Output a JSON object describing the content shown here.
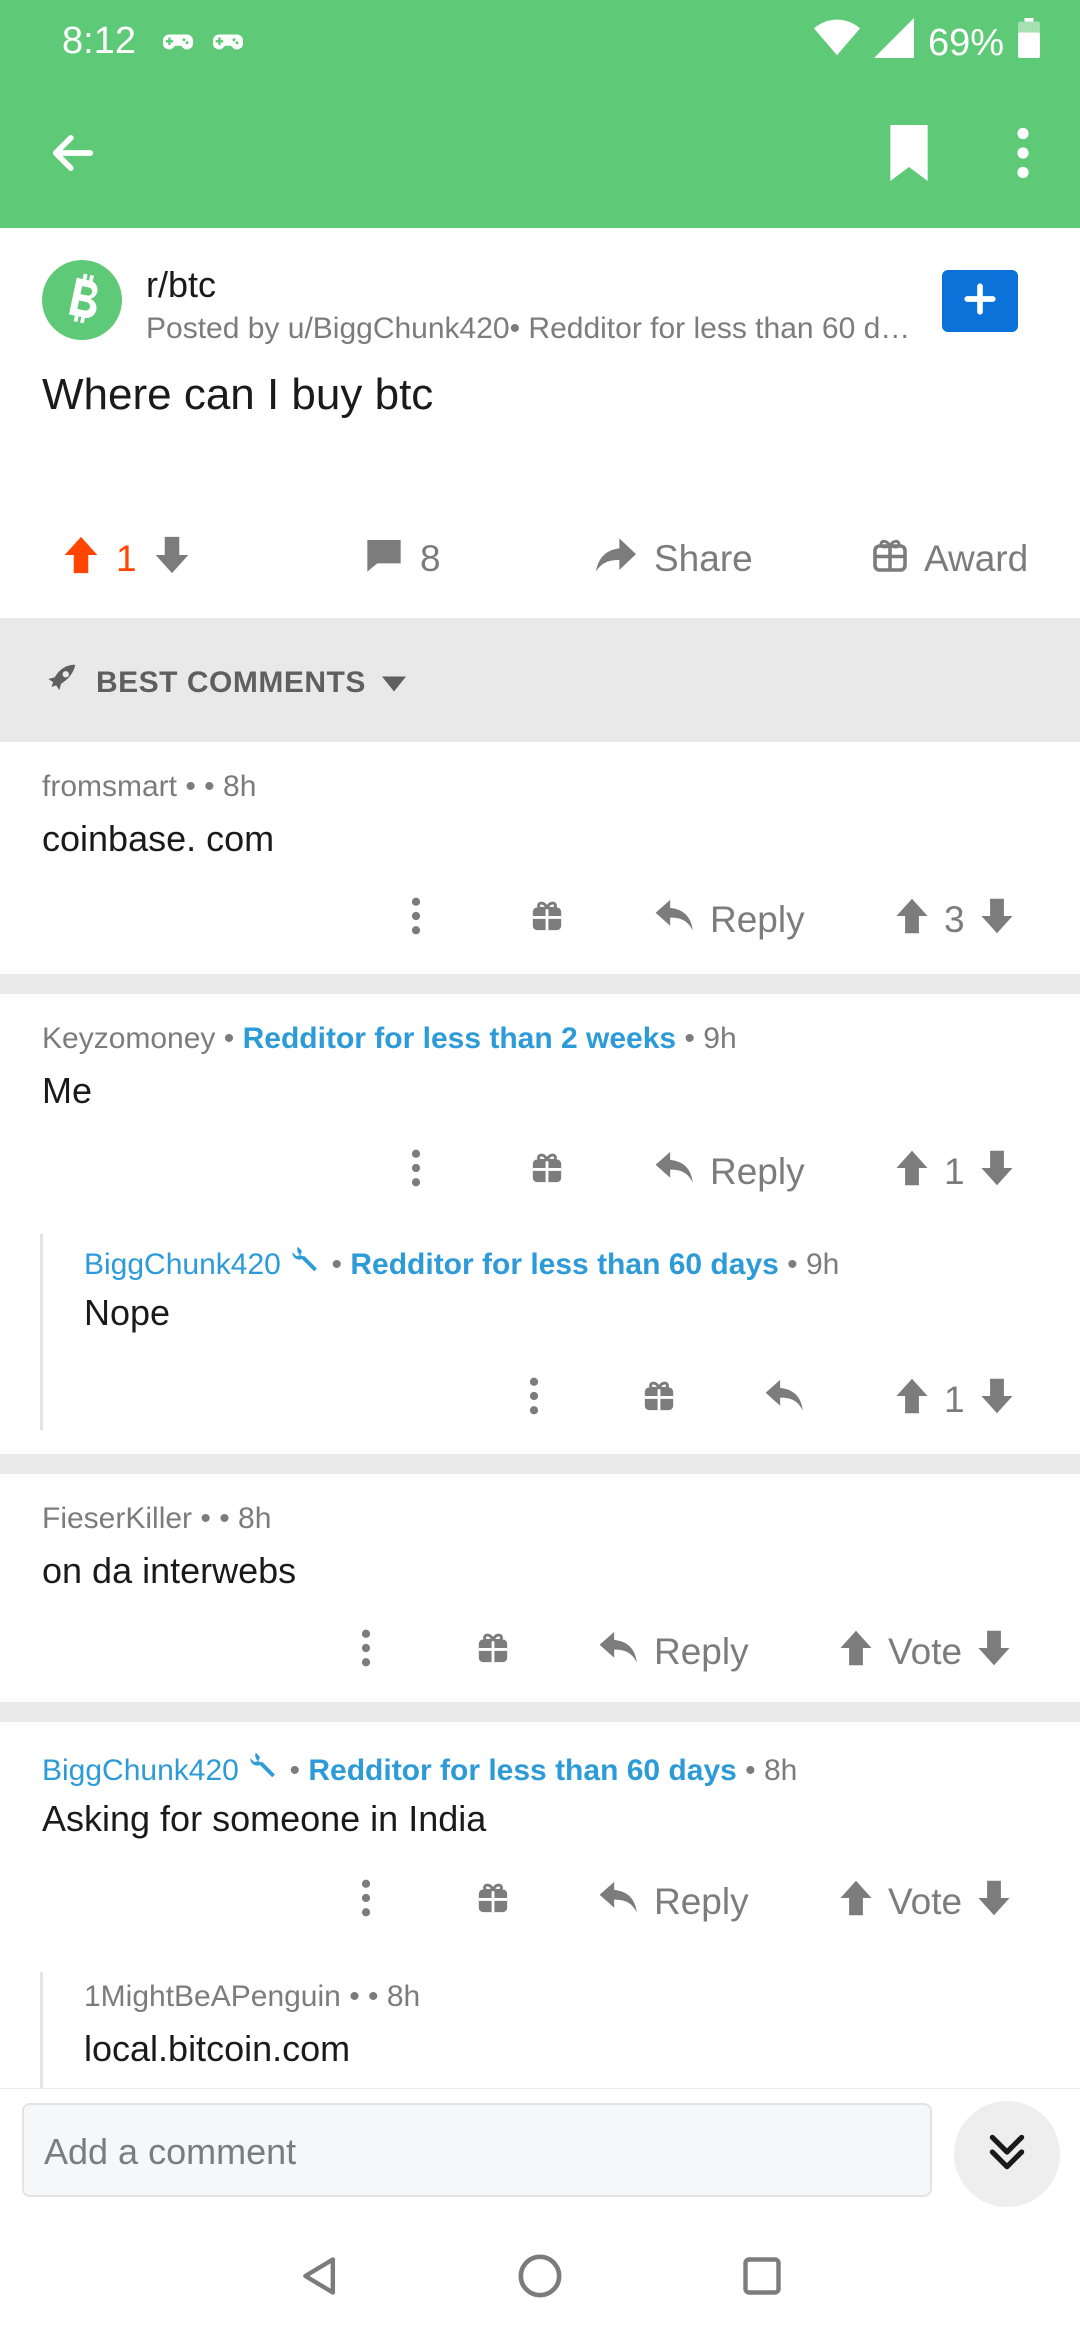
{
  "status": {
    "time": "8:12",
    "battery": "69%"
  },
  "toolbar": {
    "back": "back",
    "bookmark": "bookmark",
    "more": "more"
  },
  "post": {
    "subreddit": "r/btc",
    "posted_by": "Posted by u/BiggChunk420• Redditor for less than 60 days",
    "title": "Where can I buy btc",
    "score": "1",
    "comment_count": "8",
    "share_label": "Share",
    "award_label": "Award"
  },
  "sort": {
    "label": "BEST COMMENTS"
  },
  "comments": [
    {
      "author": "fromsmart",
      "flair": "",
      "age": "8h",
      "body": "coinbase. com",
      "reply_label": "Reply",
      "score": "3"
    },
    {
      "author": "Keyzomoney",
      "flair": "Redditor for less than 2 weeks",
      "age": "9h",
      "body": "Me",
      "reply_label": "Reply",
      "score": "1"
    },
    {
      "author": "BiggChunk420",
      "flair": "Redditor for less than 60 days",
      "age": "9h",
      "body": "Nope",
      "score": "1"
    },
    {
      "author": "FieserKiller",
      "flair": "",
      "age": "8h",
      "body": "on da interwebs",
      "reply_label": "Reply",
      "score": "Vote"
    },
    {
      "author": "BiggChunk420",
      "flair": "Redditor for less than 60 days",
      "age": "8h",
      "body": "Asking for someone in India",
      "reply_label": "Reply",
      "score": "Vote"
    },
    {
      "author": "1MightBeAPenguin",
      "flair": "",
      "age": "8h",
      "body": "local.bitcoin.com"
    }
  ],
  "composer": {
    "placeholder": "Add a comment"
  },
  "colors": {
    "header_green": "#5ec977",
    "upvote_orange": "#ff4500",
    "op_blue": "#2c9bd8",
    "join_blue": "#0a72d8"
  }
}
